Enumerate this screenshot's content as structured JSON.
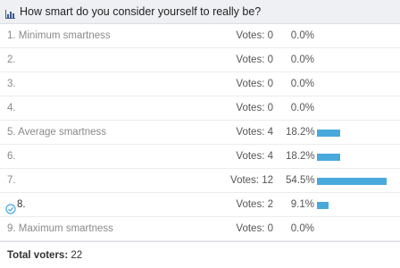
{
  "poll": {
    "question": "How smart do you consider yourself to really be?",
    "votes_prefix": "Votes:",
    "bar_color": "#4aa9dc",
    "options": [
      {
        "label": "1. Minimum smartness",
        "votes": 0,
        "percent_text": "0.0%",
        "percent": 0.0,
        "voted": false
      },
      {
        "label": "2.",
        "votes": 0,
        "percent_text": "0.0%",
        "percent": 0.0,
        "voted": false
      },
      {
        "label": "3.",
        "votes": 0,
        "percent_text": "0.0%",
        "percent": 0.0,
        "voted": false
      },
      {
        "label": "4.",
        "votes": 0,
        "percent_text": "0.0%",
        "percent": 0.0,
        "voted": false
      },
      {
        "label": "5. Average smartness",
        "votes": 4,
        "percent_text": "18.2%",
        "percent": 18.2,
        "voted": false
      },
      {
        "label": "6.",
        "votes": 4,
        "percent_text": "18.2%",
        "percent": 18.2,
        "voted": false
      },
      {
        "label": "7.",
        "votes": 12,
        "percent_text": "54.5%",
        "percent": 54.5,
        "voted": false
      },
      {
        "label": "8.",
        "votes": 2,
        "percent_text": "9.1%",
        "percent": 9.1,
        "voted": true
      },
      {
        "label": "9. Maximum smartness",
        "votes": 0,
        "percent_text": "0.0%",
        "percent": 0.0,
        "voted": false
      }
    ],
    "footer": {
      "total_label": "Total voters:",
      "total_value": "22"
    }
  }
}
